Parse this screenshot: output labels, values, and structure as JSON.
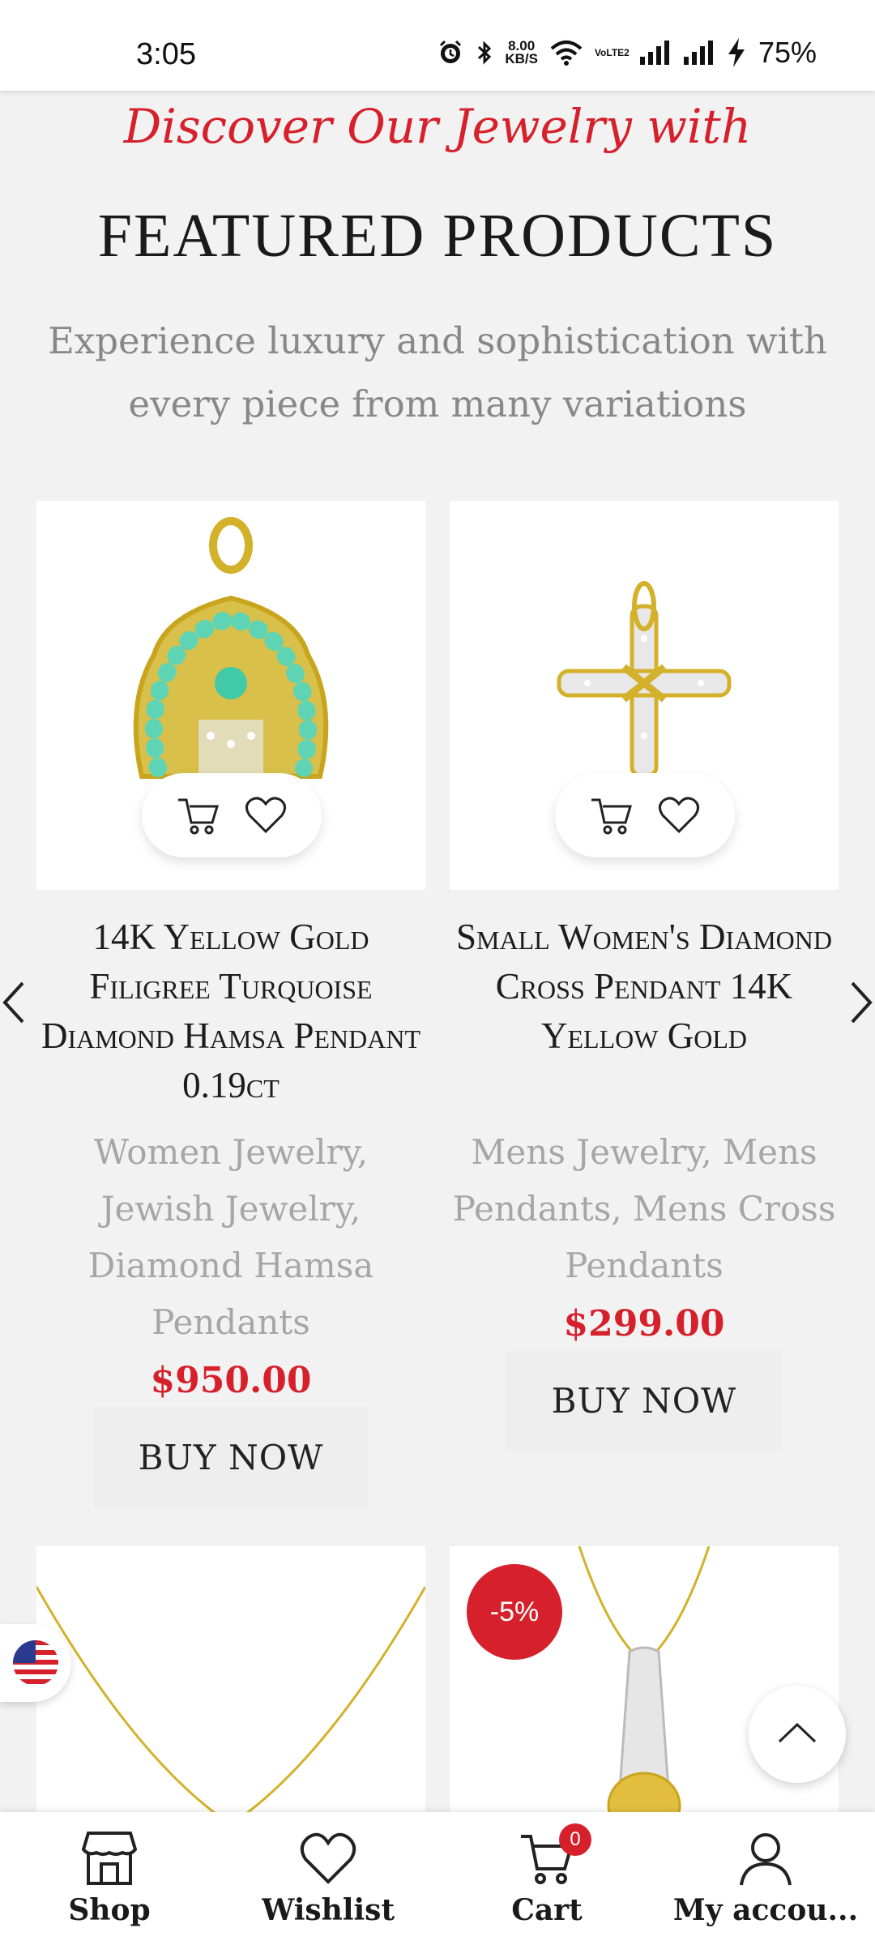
{
  "status_bar": {
    "time": "3:05",
    "net_speed_value": "8.00",
    "net_speed_unit": "KB/S",
    "network_label": "VoLTE2",
    "battery": "75%"
  },
  "header": {
    "discover": "Discover Our Jewelry with",
    "featured": "FEATURED PRODUCTS",
    "subtitle": "Experience luxury and sophistication with every piece from many variations"
  },
  "products": [
    {
      "title": "14K Yellow Gold Filigree Turquoise Diamond Hamsa Pendant 0.19ct",
      "categories": "Women Jewelry, Jewish Jewelry, Diamond Hamsa Pendants",
      "price": "$950.00",
      "buy_label": "BUY NOW"
    },
    {
      "title": "Small Women's Diamond Cross Pendant 14K Yellow Gold",
      "categories": "Mens Jewelry, Mens Pendants, Mens Cross Pendants",
      "price": "$299.00",
      "buy_label": "BUY NOW"
    }
  ],
  "next_row": {
    "badge": "-5%"
  },
  "icons": {
    "cart": "cart-icon",
    "wishlist": "heart-icon",
    "prev": "chevron-left-icon",
    "next": "chevron-right-icon",
    "scroll_top": "chevron-up-icon",
    "flag": "us-flag-icon"
  },
  "bottom_nav": {
    "shop": "Shop",
    "wishlist": "Wishlist",
    "cart": "Cart",
    "cart_count": "0",
    "account": "My accou..."
  },
  "colors": {
    "accent": "#d6202b",
    "background": "#f2f2f2"
  }
}
